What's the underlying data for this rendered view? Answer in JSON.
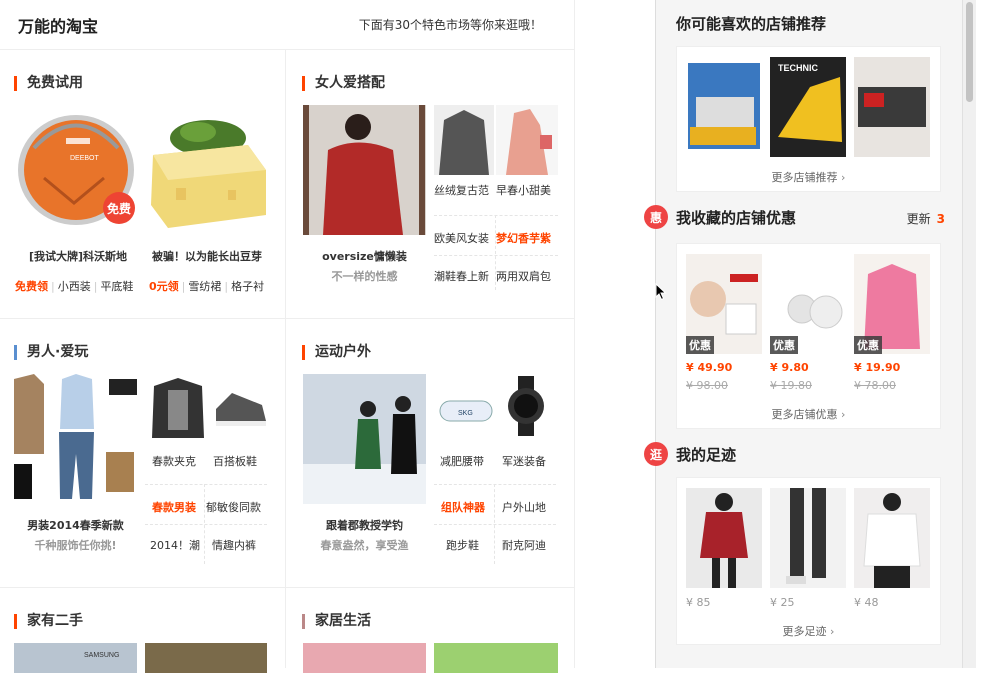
{
  "left": {
    "title": "万能的淘宝",
    "subtitle": "下面有30个特色市场等你来逛哦！",
    "sections": {
      "free_trial": {
        "title": "免费试用",
        "items": [
          {
            "caption": "[我试大牌]科沃斯地",
            "badge": "免费",
            "brand": "DEEBOT"
          },
          {
            "caption": "被骗！以为能长出豆芽"
          }
        ],
        "tags_left": [
          "免费领",
          "小西装",
          "平底鞋"
        ],
        "tags_right": [
          "0元领",
          "雪纺裙",
          "格子衬"
        ]
      },
      "women": {
        "title": "女人爱搭配",
        "main_caption": "oversize慵懒装",
        "main_sub": "不一样的性感",
        "links": [
          "丝绒复古范",
          "早春小甜美",
          "欧美风女装",
          "梦幻香芋紫",
          "潮鞋春上新",
          "两用双肩包"
        ]
      },
      "men": {
        "title": "男人·爱玩",
        "main_caption": "男装2014春季新款",
        "main_sub": "千种服饰任你挑!",
        "img_labels": [
          "春款夹克",
          "百搭板鞋"
        ],
        "links": [
          "春款男装",
          "郁敏俊同款",
          "2014！潮",
          "情趣内裤"
        ]
      },
      "sports": {
        "title": "运动户外",
        "main_caption": "跟着郡教授学钓",
        "main_sub": "春意盎然，享受渔",
        "img_labels": [
          "减肥腰带",
          "军迷装备"
        ],
        "brand": "SKG",
        "links": [
          "组队神器",
          "户外山地",
          "跑步鞋",
          "耐克阿迪"
        ]
      },
      "second_hand": {
        "title": "家有二手",
        "brand": "SAMSUNG"
      },
      "home": {
        "title": "家居生活"
      }
    }
  },
  "right": {
    "shops": {
      "title": "你可能喜欢的店铺推荐",
      "more": "更多店铺推荐",
      "brand": "TECHNIC"
    },
    "favorites": {
      "badge": "惠",
      "title": "我收藏的店铺优惠",
      "update_label": "更新",
      "update_count": "3",
      "items": [
        {
          "tag": "优惠",
          "price": "¥ 49.90",
          "old": "¥ 98.00"
        },
        {
          "tag": "优惠",
          "price": "¥ 9.80",
          "old": "¥ 19.80"
        },
        {
          "tag": "优惠",
          "price": "¥ 19.90",
          "old": "¥ 78.00"
        }
      ],
      "more": "更多店铺优惠"
    },
    "footprints": {
      "badge": "逛",
      "title": "我的足迹",
      "items": [
        {
          "price": "¥ 85"
        },
        {
          "price": "¥ 25"
        },
        {
          "price": "¥ 48"
        }
      ],
      "more": "更多足迹"
    }
  },
  "colors": {
    "accent": "#ff4400",
    "badge": "#e44444",
    "panel_bg": "#f5f5f5"
  }
}
